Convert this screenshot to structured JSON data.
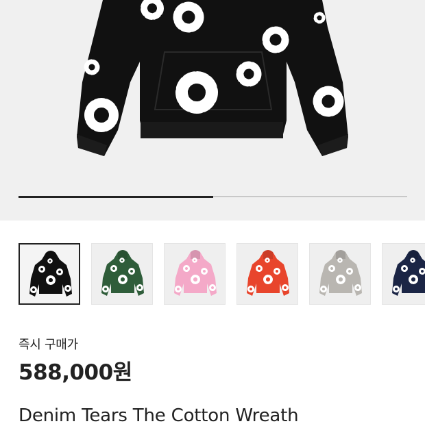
{
  "gallery": {
    "progress": 0.5,
    "main_color": "#111111",
    "thumbnails": [
      {
        "color": "#111111",
        "selected": true
      },
      {
        "color": "#2f5d3a",
        "selected": false
      },
      {
        "color": "#f4a9c8",
        "selected": false
      },
      {
        "color": "#e8452c",
        "selected": false
      },
      {
        "color": "#b9b6b1",
        "selected": false
      },
      {
        "color": "#1b2545",
        "selected": false
      }
    ]
  },
  "product": {
    "price_label": "즉시 구매가",
    "price": "588,000원",
    "name": "Denim Tears The Cotton Wreath"
  }
}
